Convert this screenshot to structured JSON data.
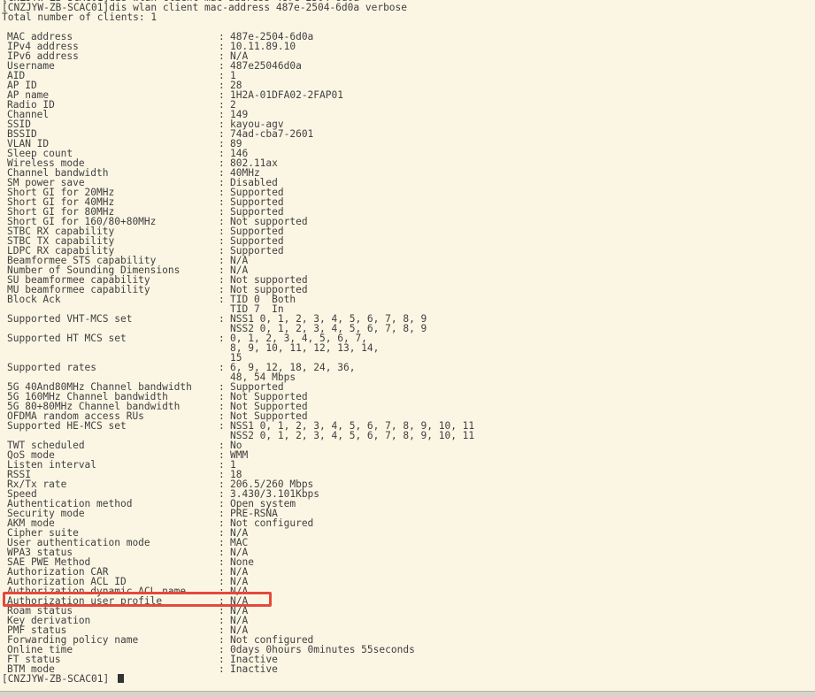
{
  "terminal": {
    "header": [
      "[CNZJYW-ZB-SCAC01]dis wlan client mac-address 487e-2504-6d0a",
      "[CNZJYW-ZB-SCAC01]dis wlan client mac-address 487e-2504-6d0a verbose",
      "Total number of clients: 1",
      ""
    ],
    "separator": ":",
    "rows": [
      {
        "key": "MAC address",
        "values": [
          "487e-2504-6d0a"
        ]
      },
      {
        "key": "IPv4 address",
        "values": [
          "10.11.89.10"
        ]
      },
      {
        "key": "IPv6 address",
        "values": [
          "N/A"
        ]
      },
      {
        "key": "Username",
        "values": [
          "487e25046d0a"
        ]
      },
      {
        "key": "AID",
        "values": [
          "1"
        ]
      },
      {
        "key": "AP ID",
        "values": [
          "28"
        ]
      },
      {
        "key": "AP name",
        "values": [
          "1H2A-01DFA02-2FAP01"
        ]
      },
      {
        "key": "Radio ID",
        "values": [
          "2"
        ]
      },
      {
        "key": "Channel",
        "values": [
          "149"
        ]
      },
      {
        "key": "SSID",
        "values": [
          "kayou-agv"
        ]
      },
      {
        "key": "BSSID",
        "values": [
          "74ad-cba7-2601"
        ]
      },
      {
        "key": "VLAN ID",
        "values": [
          "89"
        ]
      },
      {
        "key": "Sleep count",
        "values": [
          "146"
        ]
      },
      {
        "key": "Wireless mode",
        "values": [
          "802.11ax"
        ]
      },
      {
        "key": "Channel bandwidth",
        "values": [
          "40MHz"
        ]
      },
      {
        "key": "SM power save",
        "values": [
          "Disabled"
        ]
      },
      {
        "key": "Short GI for 20MHz",
        "values": [
          "Supported"
        ]
      },
      {
        "key": "Short GI for 40MHz",
        "values": [
          "Supported"
        ]
      },
      {
        "key": "Short GI for 80MHz",
        "values": [
          "Supported"
        ]
      },
      {
        "key": "Short GI for 160/80+80MHz",
        "values": [
          "Not supported"
        ]
      },
      {
        "key": "STBC RX capability",
        "values": [
          "Supported"
        ]
      },
      {
        "key": "STBC TX capability",
        "values": [
          "Supported"
        ]
      },
      {
        "key": "LDPC RX capability",
        "values": [
          "Supported"
        ]
      },
      {
        "key": "Beamformee STS capability",
        "values": [
          "N/A"
        ]
      },
      {
        "key": "Number of Sounding Dimensions",
        "values": [
          "N/A"
        ]
      },
      {
        "key": "SU beamformee capability",
        "values": [
          "Not supported"
        ]
      },
      {
        "key": "MU beamformee capability",
        "values": [
          "Not supported"
        ]
      },
      {
        "key": "Block Ack",
        "values": [
          "TID 0  Both",
          "TID 7  In"
        ]
      },
      {
        "key": "Supported VHT-MCS set",
        "values": [
          "NSS1 0, 1, 2, 3, 4, 5, 6, 7, 8, 9",
          "NSS2 0, 1, 2, 3, 4, 5, 6, 7, 8, 9"
        ]
      },
      {
        "key": "Supported HT MCS set",
        "values": [
          "0, 1, 2, 3, 4, 5, 6, 7,",
          "8, 9, 10, 11, 12, 13, 14,",
          "15"
        ]
      },
      {
        "key": "Supported rates",
        "values": [
          "6, 9, 12, 18, 24, 36,",
          "48, 54 Mbps"
        ]
      },
      {
        "key": "5G 40And80MHz Channel bandwidth",
        "values": [
          "Supported"
        ]
      },
      {
        "key": "5G 160MHz Channel bandwidth",
        "values": [
          "Not Supported"
        ]
      },
      {
        "key": "5G 80+80MHz Channel bandwidth",
        "values": [
          "Not Supported"
        ]
      },
      {
        "key": "OFDMA random access RUs",
        "values": [
          "Not Supported"
        ]
      },
      {
        "key": "Supported HE-MCS set",
        "values": [
          "NSS1 0, 1, 2, 3, 4, 5, 6, 7, 8, 9, 10, 11",
          "NSS2 0, 1, 2, 3, 4, 5, 6, 7, 8, 9, 10, 11"
        ]
      },
      {
        "key": "TWT scheduled",
        "values": [
          "No"
        ]
      },
      {
        "key": "QoS mode",
        "values": [
          "WMM"
        ]
      },
      {
        "key": "Listen interval",
        "values": [
          "1"
        ]
      },
      {
        "key": "RSSI",
        "values": [
          "18"
        ]
      },
      {
        "key": "Rx/Tx rate",
        "values": [
          "206.5/260 Mbps"
        ]
      },
      {
        "key": "Speed",
        "values": [
          "3.430/3.101Kbps"
        ]
      },
      {
        "key": "Authentication method",
        "values": [
          "Open system"
        ]
      },
      {
        "key": "Security mode",
        "values": [
          "PRE-RSNA"
        ]
      },
      {
        "key": "AKM mode",
        "values": [
          "Not configured"
        ]
      },
      {
        "key": "Cipher suite",
        "values": [
          "N/A"
        ]
      },
      {
        "key": "User authentication mode",
        "values": [
          "MAC"
        ]
      },
      {
        "key": "WPA3 status",
        "values": [
          "N/A"
        ]
      },
      {
        "key": "SAE PWE Method",
        "values": [
          "None"
        ]
      },
      {
        "key": "Authorization CAR",
        "values": [
          "N/A"
        ]
      },
      {
        "key": "Authorization ACL ID",
        "values": [
          "N/A"
        ]
      },
      {
        "key": "Authorization dynamic ACL name",
        "values": [
          "N/A"
        ]
      },
      {
        "key": "Authorization user profile",
        "values": [
          "N/A"
        ],
        "highlighted": true
      },
      {
        "key": "Roam status",
        "values": [
          "N/A"
        ]
      },
      {
        "key": "Key derivation",
        "values": [
          "N/A"
        ]
      },
      {
        "key": "PMF status",
        "values": [
          "N/A"
        ]
      },
      {
        "key": "Forwarding policy name",
        "values": [
          "Not configured"
        ]
      },
      {
        "key": "Online time",
        "values": [
          "0days 0hours 0minutes 55seconds"
        ]
      },
      {
        "key": "FT status",
        "values": [
          "Inactive"
        ]
      },
      {
        "key": "BTM mode",
        "values": [
          "Inactive"
        ]
      }
    ],
    "prompt": "[CNZJYW-ZB-SCAC01] "
  },
  "colors": {
    "background": "#fbf6e4",
    "text": "#404040",
    "highlight": "#e5493d"
  }
}
